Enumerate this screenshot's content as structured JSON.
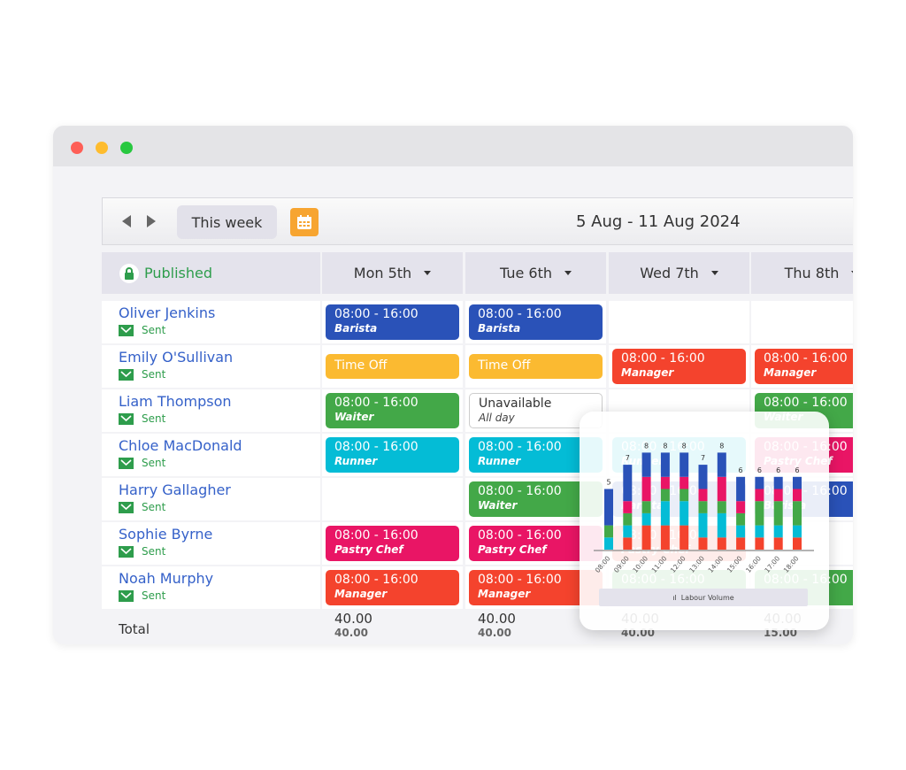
{
  "toolbar": {
    "this_week": "This week",
    "date_range": "5 Aug - 11 Aug 2024"
  },
  "status": {
    "label": "Published",
    "color": "#2e9d4c"
  },
  "days": [
    "Mon 5th",
    "Tue 6th",
    "Wed 7th",
    "Thu 8th"
  ],
  "sent_label": "Sent",
  "staff": [
    {
      "name": "Oliver Jenkins",
      "shifts": [
        {
          "time": "08:00 - 16:00",
          "role": "Barista",
          "color": "#2a52b8"
        },
        {
          "time": "08:00 - 16:00",
          "role": "Barista",
          "color": "#2a52b8"
        },
        null,
        null
      ]
    },
    {
      "name": "Emily O'Sullivan",
      "shifts": [
        {
          "type": "timeoff",
          "time": "Time Off",
          "color": "#fbba31"
        },
        {
          "type": "timeoff",
          "time": "Time Off",
          "color": "#fbba31"
        },
        {
          "time": "08:00 - 16:00",
          "role": "Manager",
          "color": "#f4432d"
        },
        {
          "time": "08:00 - 16:00",
          "role": "Manager",
          "color": "#f4432d"
        }
      ]
    },
    {
      "name": "Liam Thompson",
      "shifts": [
        {
          "time": "08:00 - 16:00",
          "role": "Waiter",
          "color": "#43a848"
        },
        {
          "type": "unavailable",
          "time": "Unavailable",
          "role": "All day"
        },
        null,
        {
          "time": "08:00 - 16:00",
          "role": "Waiter",
          "color": "#43a848"
        }
      ]
    },
    {
      "name": "Chloe MacDonald",
      "shifts": [
        {
          "time": "08:00 - 16:00",
          "role": "Runner",
          "color": "#04bcd6"
        },
        {
          "time": "08:00 - 16:00",
          "role": "Runner",
          "color": "#04bcd6"
        },
        {
          "time": "08:00 - 16:00",
          "role": "Runner",
          "color": "#04bcd6"
        },
        {
          "time": "08:00 - 16:00",
          "role": "Pastry Chef",
          "color": "#e91565"
        }
      ]
    },
    {
      "name": "Harry Gallagher",
      "shifts": [
        null,
        {
          "time": "08:00 - 16:00",
          "role": "Waiter",
          "color": "#43a848"
        },
        {
          "time": "08:00 - 16:00",
          "role": "Barista",
          "color": "#2a52b8"
        },
        {
          "time": "08:00 - 16:00",
          "role": "Barista",
          "color": "#2a52b8"
        }
      ]
    },
    {
      "name": "Sophie Byrne",
      "shifts": [
        {
          "time": "08:00 - 16:00",
          "role": "Pastry Chef",
          "color": "#e91565"
        },
        {
          "time": "08:00 - 16:00",
          "role": "Pastry Chef",
          "color": "#e91565"
        },
        {
          "time": "08:00 - 16:00",
          "role": "Pastry Chef",
          "color": "#f4432d"
        },
        null
      ]
    },
    {
      "name": "Noah Murphy",
      "shifts": [
        {
          "time": "08:00 - 16:00",
          "role": "Manager",
          "color": "#f4432d"
        },
        {
          "time": "08:00 - 16:00",
          "role": "Manager",
          "color": "#f4432d"
        },
        {
          "time": "08:00 - 16:00",
          "role": "",
          "color": "#43a848"
        },
        {
          "time": "08:00 - 16:00",
          "role": "",
          "color": "#43a848"
        }
      ]
    }
  ],
  "totals": {
    "label": "Total",
    "values": [
      [
        "40.00",
        "40.00"
      ],
      [
        "40.00",
        "40.00"
      ],
      [
        "40.00",
        "40.00"
      ],
      [
        "40.00",
        "15.00"
      ]
    ]
  },
  "chart_data": {
    "type": "bar",
    "stacked": true,
    "title": "Labour Volume",
    "categories": [
      "08:00",
      "09:00",
      "10:00",
      "11:00",
      "12:00",
      "13:00",
      "14:00",
      "15:00",
      "16:00",
      "17:00",
      "18:00"
    ],
    "totals": [
      5,
      7,
      8,
      8,
      8,
      7,
      8,
      6,
      6,
      6,
      6
    ],
    "series": [
      {
        "color": "#f4432d",
        "values": [
          0,
          1,
          2,
          2,
          2,
          1,
          1,
          1,
          1,
          1,
          1
        ]
      },
      {
        "color": "#04bcd6",
        "values": [
          1,
          1,
          1,
          2,
          2,
          2,
          2,
          1,
          1,
          1,
          1
        ]
      },
      {
        "color": "#43a848",
        "values": [
          1,
          1,
          1,
          1,
          1,
          1,
          1,
          1,
          2,
          2,
          2
        ]
      },
      {
        "color": "#e91565",
        "values": [
          0,
          1,
          2,
          1,
          1,
          1,
          2,
          1,
          1,
          1,
          1
        ]
      },
      {
        "color": "#2a52b8",
        "values": [
          3,
          3,
          2,
          2,
          2,
          2,
          2,
          2,
          1,
          1,
          1
        ]
      }
    ]
  }
}
